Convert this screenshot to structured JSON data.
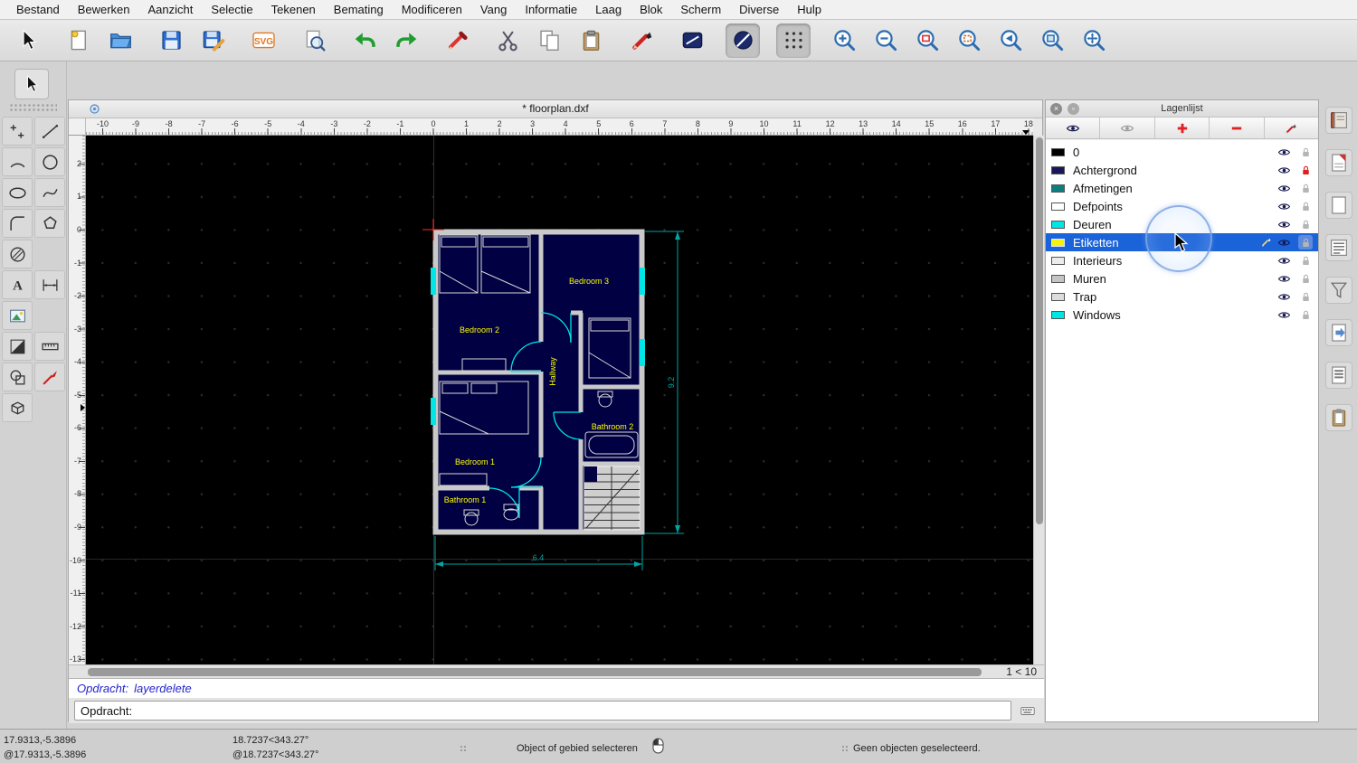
{
  "colors": {
    "selection_blue": "#1b63d8",
    "dimension_teal": "#00a5a5",
    "label_yellow": "#ffff00",
    "canvas_black": "#000000",
    "locked_red": "#dd2222"
  },
  "menu_bar": {
    "items": [
      "Bestand",
      "Bewerken",
      "Aanzicht",
      "Selectie",
      "Tekenen",
      "Bemating",
      "Modificeren",
      "Vang",
      "Informatie",
      "Laag",
      "Blok",
      "Scherm",
      "Diverse",
      "Hulp"
    ]
  },
  "toolbar": {
    "buttons": [
      {
        "name": "select-tool-button",
        "icon": "cursor",
        "gap": false,
        "active": false
      },
      {
        "name": "new-file-button",
        "icon": "new-file",
        "gap": true,
        "active": false
      },
      {
        "name": "open-file-button",
        "icon": "open-folder",
        "gap": false,
        "active": false
      },
      {
        "name": "save-button",
        "icon": "save",
        "gap": true,
        "active": false
      },
      {
        "name": "save-as-button",
        "icon": "save-as",
        "gap": false,
        "active": false
      },
      {
        "name": "svg-export-button",
        "icon": "svg-export",
        "gap": true,
        "active": false
      },
      {
        "name": "print-preview-button",
        "icon": "print-preview",
        "gap": true,
        "active": false
      },
      {
        "name": "undo-button",
        "icon": "undo",
        "gap": true,
        "active": false
      },
      {
        "name": "redo-button",
        "icon": "redo",
        "gap": false,
        "active": false
      },
      {
        "name": "delete-button",
        "icon": "delete-pen",
        "gap": true,
        "active": false
      },
      {
        "name": "cut-button",
        "icon": "cut",
        "gap": true,
        "active": false
      },
      {
        "name": "copy-button",
        "icon": "copy",
        "gap": false,
        "active": false
      },
      {
        "name": "paste-button",
        "icon": "paste",
        "gap": false,
        "active": false
      },
      {
        "name": "pen-button",
        "icon": "edit-pen",
        "gap": true,
        "active": false
      },
      {
        "name": "attributes-button",
        "icon": "attributes",
        "gap": true,
        "active": false
      },
      {
        "name": "no-print-toggle",
        "icon": "circle-slash",
        "gap": true,
        "active": true
      },
      {
        "name": "grid-toggle",
        "icon": "grid-dots",
        "gap": true,
        "active": true
      },
      {
        "name": "zoom-in-button",
        "icon": "zoom-in",
        "gap": true,
        "active": false
      },
      {
        "name": "zoom-out-button",
        "icon": "zoom-out",
        "gap": false,
        "active": false
      },
      {
        "name": "zoom-auto-button",
        "icon": "zoom-auto",
        "gap": false,
        "active": false
      },
      {
        "name": "zoom-select-button",
        "icon": "zoom-select",
        "gap": false,
        "active": false
      },
      {
        "name": "zoom-previous-button",
        "icon": "zoom-previous",
        "gap": false,
        "active": false
      },
      {
        "name": "zoom-window-button",
        "icon": "zoom-window",
        "gap": false,
        "active": false
      },
      {
        "name": "zoom-pan-button",
        "icon": "zoom-pan",
        "gap": false,
        "active": false
      }
    ]
  },
  "palette": {
    "select": {
      "name": "select-tool",
      "icon": "cursor"
    },
    "rows": [
      [
        {
          "name": "point-tool",
          "icon": "point"
        },
        {
          "name": "line-tool",
          "icon": "line"
        }
      ],
      [
        {
          "name": "arc-tool",
          "icon": "arc"
        },
        {
          "name": "circle-tool",
          "icon": "circle"
        }
      ],
      [
        {
          "name": "ellipse-tool",
          "icon": "ellipse"
        },
        {
          "name": "spline-tool",
          "icon": "spline"
        }
      ],
      [
        {
          "name": "fillet-tool",
          "icon": "fillet"
        },
        {
          "name": "polygon-tool",
          "icon": "polygon"
        }
      ],
      [
        {
          "name": "hatch-tool",
          "icon": "hatch"
        },
        null
      ],
      [
        {
          "name": "text-tool",
          "icon": "text"
        },
        {
          "name": "dimension-tool",
          "icon": "dimension"
        }
      ],
      [
        {
          "name": "image-tool",
          "icon": "image"
        },
        null
      ],
      [
        {
          "name": "fill-tool",
          "icon": "fill"
        },
        {
          "name": "measure-tool",
          "icon": "measure"
        }
      ],
      [
        {
          "name": "region-tool",
          "icon": "region"
        },
        {
          "name": "snap-tool",
          "icon": "snap"
        }
      ],
      [
        {
          "name": "isometric-tool",
          "icon": "box3d"
        },
        null
      ]
    ]
  },
  "document": {
    "title": "* floorplan.dxf"
  },
  "rulers": {
    "horizontal": [
      "-10",
      "-9",
      "-8",
      "-7",
      "-6",
      "-5",
      "-4",
      "-3",
      "-2",
      "-1",
      "0",
      "1",
      "2",
      "3",
      "4",
      "5",
      "6",
      "7",
      "8",
      "9",
      "10",
      "11",
      "12",
      "13",
      "14",
      "15",
      "16",
      "17",
      "18"
    ],
    "vertical": [
      "2",
      "1",
      "0",
      "-1",
      "-2",
      "-3",
      "-4",
      "-5",
      "-6",
      "-7",
      "-8",
      "-9",
      "-10",
      "-11",
      "-12",
      "-13"
    ]
  },
  "floorplan": {
    "labels": {
      "bedroom3": "Bedroom 3",
      "bedroom2": "Bedroom 2",
      "bedroom1": "Bedroom 1",
      "bathroom1": "Bathroom 1",
      "bathroom2": "Bathroom 2",
      "hallway": "Hallway"
    },
    "dim_height": "9.2",
    "dim_width": "6.4"
  },
  "scroll": {
    "page_indicator": "1 < 10"
  },
  "command": {
    "history_label": "Opdracht:",
    "history_value": "layerdelete",
    "prompt_label": "Opdracht:",
    "input_value": ""
  },
  "layer_panel": {
    "title": "Lagenlijst",
    "toolbar": [
      {
        "name": "show-all-layers-button",
        "icon": "eye-dark"
      },
      {
        "name": "hide-all-layers-button",
        "icon": "eye-light"
      },
      {
        "name": "add-layer-button",
        "icon": "plus-red"
      },
      {
        "name": "remove-layer-button",
        "icon": "minus-red"
      },
      {
        "name": "edit-layer-button",
        "icon": "pencil"
      }
    ],
    "layers": [
      {
        "name": "0",
        "swatch": "#000000",
        "visible": true,
        "locked": false,
        "selected": false
      },
      {
        "name": "Achtergrond",
        "swatch": "#181858",
        "visible": true,
        "locked": true,
        "selected": false
      },
      {
        "name": "Afmetingen",
        "swatch": "#0d7d7d",
        "visible": true,
        "locked": false,
        "selected": false
      },
      {
        "name": "Defpoints",
        "swatch": "#ffffff",
        "visible": true,
        "locked": false,
        "selected": false
      },
      {
        "name": "Deuren",
        "swatch": "#00e5e5",
        "visible": true,
        "locked": false,
        "selected": false
      },
      {
        "name": "Etiketten",
        "swatch": "#f2f20c",
        "visible": true,
        "locked": false,
        "selected": true
      },
      {
        "name": "Interieurs",
        "swatch": "#ececec",
        "visible": true,
        "locked": false,
        "selected": false
      },
      {
        "name": "Muren",
        "swatch": "#c4c4c4",
        "visible": true,
        "locked": false,
        "selected": false
      },
      {
        "name": "Trap",
        "swatch": "#dcdcdc",
        "visible": true,
        "locked": false,
        "selected": false
      },
      {
        "name": "Windows",
        "swatch": "#00e5e5",
        "visible": true,
        "locked": false,
        "selected": false
      }
    ]
  },
  "dock": {
    "icons": [
      {
        "name": "library-browser-panel-icon",
        "icon": "dock-book"
      },
      {
        "name": "layer-list-panel-icon",
        "icon": "dock-page-red"
      },
      {
        "name": "block-list-panel-icon",
        "icon": "dock-page"
      },
      {
        "name": "entity-list-panel-icon",
        "icon": "dock-list"
      },
      {
        "name": "selection-filter-panel-icon",
        "icon": "dock-funnel"
      },
      {
        "name": "reference-panel-icon",
        "icon": "dock-page-arrow"
      },
      {
        "name": "command-history-panel-icon",
        "icon": "dock-doc"
      },
      {
        "name": "clipboard-panel-icon",
        "icon": "dock-clipboard"
      }
    ]
  },
  "status_bar": {
    "absolute_coord": "17.9313,-5.3896",
    "relative_coord": "@17.9313,-5.3896",
    "absolute_polar": "18.7237<343.27°",
    "relative_polar": "@18.7237<343.27°",
    "hint": "Object of gebied selecteren",
    "selection_info": "Geen objecten geselecteerd."
  }
}
